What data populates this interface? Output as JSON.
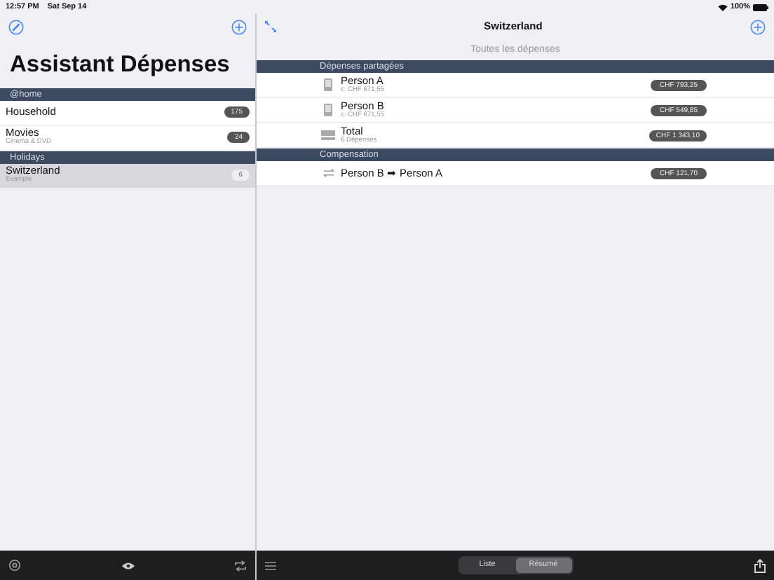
{
  "status_bar": {
    "time": "12:57 PM",
    "date": "Sat Sep 14",
    "battery": "100%"
  },
  "sidebar": {
    "title": "Assistant Dépenses",
    "groups": [
      {
        "header": "@home",
        "items": [
          {
            "name": "Household",
            "count": "175",
            "selected": false
          },
          {
            "name": "Movies",
            "subtitle": "Cinema & DVD",
            "count": "24",
            "selected": false
          }
        ]
      },
      {
        "header": "Holidays",
        "items": [
          {
            "name": "Switzerland",
            "subtitle": "Example",
            "count": "6",
            "selected": true
          }
        ]
      }
    ]
  },
  "detail": {
    "title": "Switzerland",
    "filter": "Toutes les dépenses",
    "sections": [
      {
        "header": "Dépenses partagées",
        "rows": [
          {
            "kind": "person",
            "label": "Person A",
            "sub": "c: CHF 671,55",
            "amount": "CHF 793,25"
          },
          {
            "kind": "person",
            "label": "Person B",
            "sub": "c: CHF 671,55",
            "amount": "CHF 549,85"
          },
          {
            "kind": "total",
            "label": "Total",
            "sub": "6 Dépenses",
            "amount": "CHF 1 343,10"
          }
        ]
      },
      {
        "header": "Compensation",
        "rows": [
          {
            "kind": "transfer",
            "label": "Person B ➡ Person A",
            "amount": "CHF 121,70"
          }
        ]
      }
    ]
  },
  "toolbar": {
    "segments": [
      {
        "label": "Liste",
        "selected": false
      },
      {
        "label": "Résumé",
        "selected": true
      }
    ]
  }
}
